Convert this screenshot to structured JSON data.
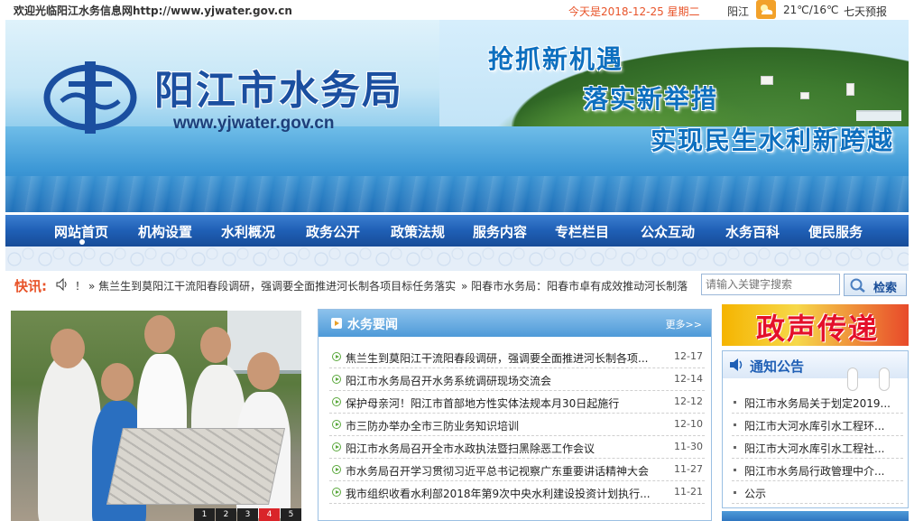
{
  "topbar": {
    "welcome": "欢迎光临阳江水务信息网http://www.yjwater.gov.cn",
    "today": "今天是2018-12-25 星期二",
    "city": "阳江",
    "weather_icon": "sun-cloud-icon",
    "temperature": "21℃/16℃",
    "forecast": "七天预报"
  },
  "banner": {
    "org_name": "阳江市水务局",
    "site_url": "www.yjwater.gov.cn",
    "slogans": [
      "抢抓新机遇",
      "落实新举措",
      "实现民生水利新跨越"
    ]
  },
  "nav": {
    "items": [
      "网站首页",
      "机构设置",
      "水利概况",
      "政务公开",
      "政策法规",
      "服务内容",
      "专栏栏目",
      "公众互动",
      "水务百科",
      "便民服务"
    ]
  },
  "ticker": {
    "label": "快讯:",
    "excl": "！",
    "items": [
      "» 焦兰生到莫阳江干流阳春段调研，强调要全面推进河长制各项目标任务落实",
      "» 阳春市水务局：阳春市卓有成效推动河长制落"
    ]
  },
  "search": {
    "placeholder": "请输入关键字搜索",
    "button": "检索"
  },
  "slideshow": {
    "pages": [
      "1",
      "2",
      "3",
      "4",
      "5"
    ],
    "active_page": "4"
  },
  "news": {
    "title": "水务要闻",
    "more": "更多>>",
    "items": [
      {
        "title": "焦兰生到莫阳江干流阳春段调研，强调要全面推进河长制各项...",
        "date": "12-17"
      },
      {
        "title": "阳江市水务局召开水务系统调研现场交流会",
        "date": "12-14"
      },
      {
        "title": "保护母亲河！阳江市首部地方性实体法规本月30日起施行",
        "date": "12-12"
      },
      {
        "title": "市三防办举办全市三防业务知识培训",
        "date": "12-10"
      },
      {
        "title": "阳江市水务局召开全市水政执法暨扫黑除恶工作会议",
        "date": "11-30"
      },
      {
        "title": "市水务局召开学习贯彻习近平总书记视察广东重要讲话精神大会",
        "date": "11-27"
      },
      {
        "title": "我市组织收看水利部2018年第9次中央水利建设投资计划执行...",
        "date": "11-21"
      }
    ]
  },
  "right": {
    "promo": "政声传递",
    "notice_title": "通知公告",
    "notices": [
      "阳江市水务局关于划定2019...",
      "阳江市大河水库引水工程环...",
      "阳江市大河水库引水工程社...",
      "阳江市水务局行政管理中介...",
      "公示"
    ]
  },
  "colors": {
    "nav_blue": "#1f5fb5",
    "accent_orange": "#e8542a",
    "slide_active": "#d9252a"
  }
}
